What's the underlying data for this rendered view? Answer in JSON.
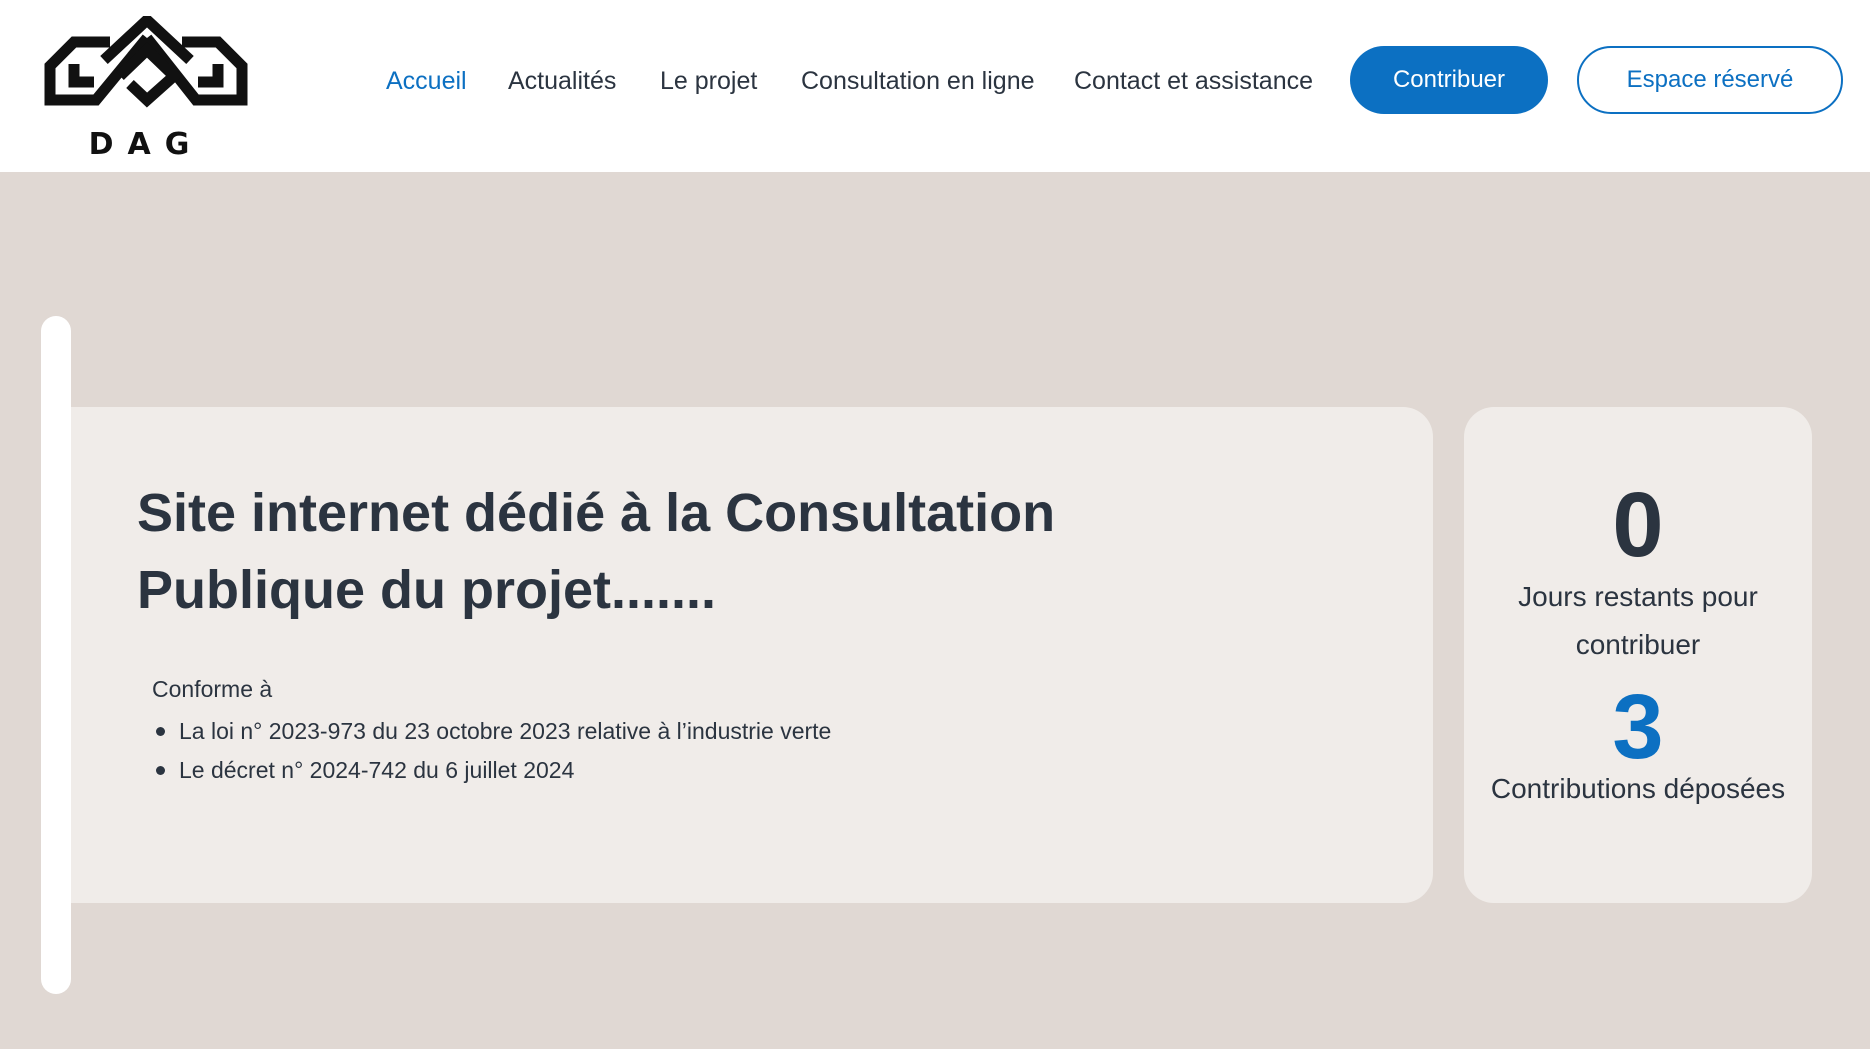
{
  "logo": {
    "text": "DAG"
  },
  "nav": {
    "items": [
      {
        "label": "Accueil",
        "active": true
      },
      {
        "label": "Actualités",
        "active": false
      },
      {
        "label": "Le projet",
        "active": false
      },
      {
        "label": "Consultation en ligne",
        "active": false
      },
      {
        "label": "Contact et assistance",
        "active": false
      }
    ],
    "contribute_label": "Contribuer",
    "reserved_label": "Espace réservé"
  },
  "hero": {
    "title": "Site internet dédié à la Consultation Publique du projet.......",
    "conform_label": "Conforme à",
    "conform_items": [
      "La loi n° 2023-973 du 23 octobre 2023 relative à l’industrie verte",
      "Le décret n° 2024-742 du 6 juillet 2024"
    ]
  },
  "stats": {
    "days_remaining": "0",
    "days_label": "Jours restants pour contribuer",
    "contributions": "3",
    "contributions_label": "Contributions déposées"
  },
  "colors": {
    "accent": "#0c70c2",
    "page_background": "#e0d8d3",
    "card_background": "#f0ece9",
    "text": "#2b3440"
  }
}
